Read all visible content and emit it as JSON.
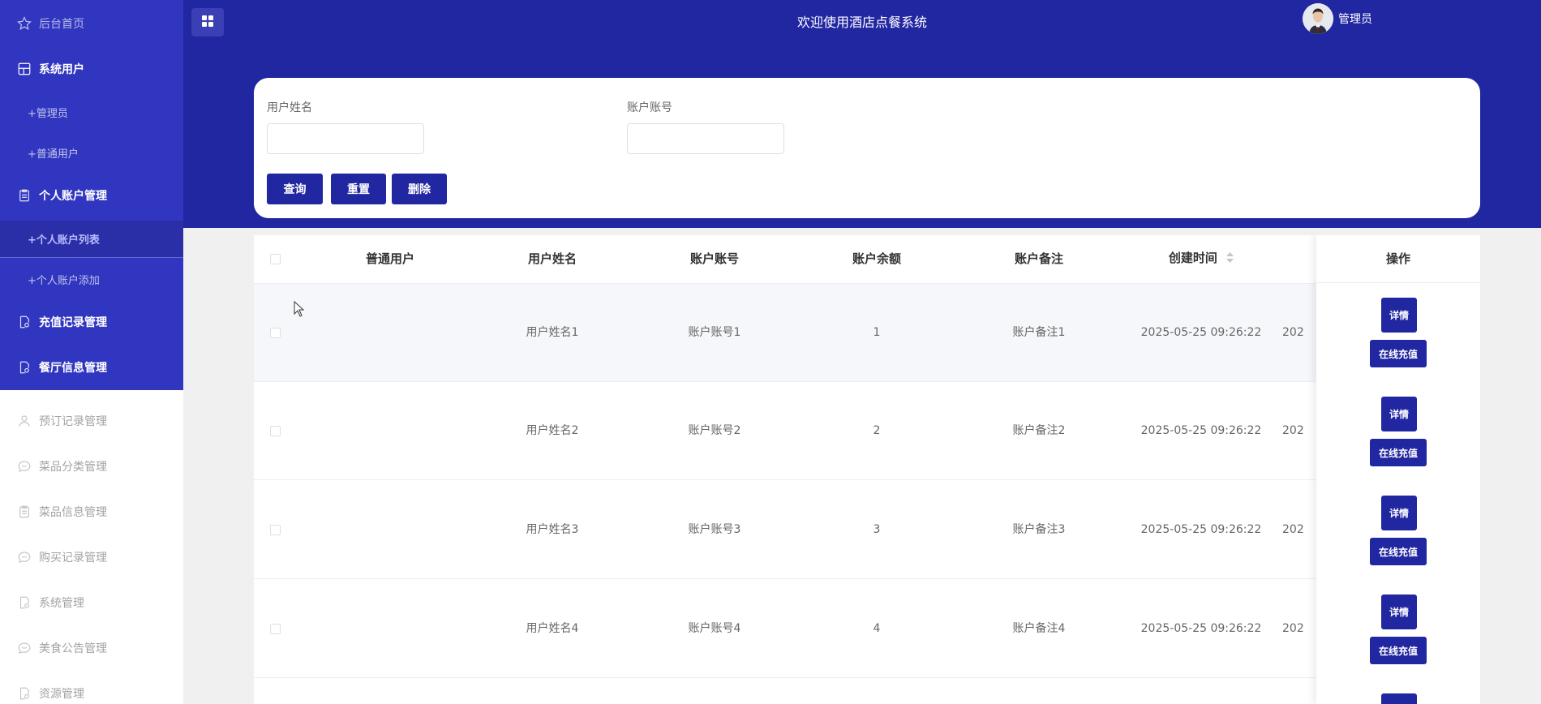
{
  "sidebar": {
    "items": [
      {
        "label": "后台首页",
        "icon": "star-icon"
      },
      {
        "label": "系统用户",
        "icon": "grid-icon"
      },
      {
        "label": "+管理员"
      },
      {
        "label": "+普通用户"
      },
      {
        "label": "个人账户管理",
        "icon": "clipboard-icon"
      },
      {
        "label": "+个人账户列表"
      },
      {
        "label": "+个人账户添加"
      },
      {
        "label": "充值记录管理",
        "icon": "document-search-icon"
      },
      {
        "label": "餐厅信息管理",
        "icon": "document-search-icon"
      },
      {
        "label": "预订记录管理",
        "icon": "user-icon"
      },
      {
        "label": "菜品分类管理",
        "icon": "chat-icon"
      },
      {
        "label": "菜品信息管理",
        "icon": "clipboard-icon"
      },
      {
        "label": "购买记录管理",
        "icon": "chat-icon"
      },
      {
        "label": "系统管理",
        "icon": "document-search-icon"
      },
      {
        "label": "美食公告管理",
        "icon": "chat-icon"
      },
      {
        "label": "资源管理",
        "icon": "document-search-icon"
      }
    ]
  },
  "header": {
    "title": "欢迎使用酒店点餐系统",
    "user_name": "管理员"
  },
  "search": {
    "name_label": "用户姓名",
    "name_value": "",
    "account_label": "账户账号",
    "account_value": "",
    "query_label": "查询",
    "reset_label": "重置",
    "delete_label": "删除"
  },
  "table": {
    "columns": [
      "普通用户",
      "用户姓名",
      "账户账号",
      "账户余额",
      "账户备注",
      "创建时间",
      "操作"
    ],
    "rows": [
      {
        "user": "",
        "name": "用户姓名1",
        "account": "账户账号1",
        "balance": "1",
        "remark": "账户备注1",
        "created": "2025-05-25 09:26:22",
        "next": "202"
      },
      {
        "user": "",
        "name": "用户姓名2",
        "account": "账户账号2",
        "balance": "2",
        "remark": "账户备注2",
        "created": "2025-05-25 09:26:22",
        "next": "202"
      },
      {
        "user": "",
        "name": "用户姓名3",
        "account": "账户账号3",
        "balance": "3",
        "remark": "账户备注3",
        "created": "2025-05-25 09:26:22",
        "next": "202"
      },
      {
        "user": "",
        "name": "用户姓名4",
        "account": "账户账号4",
        "balance": "4",
        "remark": "账户备注4",
        "created": "2025-05-25 09:26:22",
        "next": "202"
      }
    ],
    "detail_label": "详情",
    "recharge_label": "在线充值"
  },
  "colors": {
    "primary": "#2126a1",
    "sidebar": "#3036bf",
    "background": "#f0f0f0"
  }
}
